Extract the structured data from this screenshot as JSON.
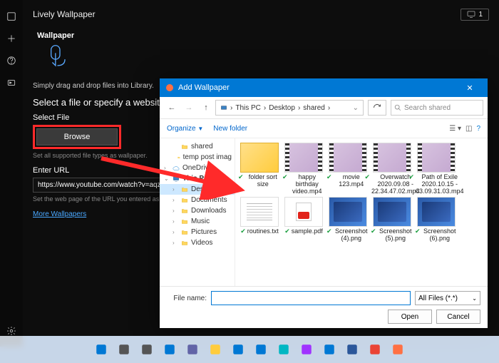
{
  "app": {
    "title": "Lively Wallpaper",
    "monitor_count": "1"
  },
  "wallpaper": {
    "heading": "Wallpaper",
    "drag_hint": "Simply drag and drop files into Library.",
    "select_line": "Select a file or specify a website url to",
    "select_file_label": "Select File",
    "browse_label": "Browse",
    "browse_hint": "Set all supported file types as wallpaper.",
    "url_label": "Enter URL",
    "url_value": "https://www.youtube.com/watch?v=aqz-KE",
    "url_hint": "Set the web page of the URL you entered as wallpaper.",
    "more_link": "More Wallpapers"
  },
  "dialog": {
    "title": "Add Wallpaper",
    "breadcrumb": [
      "This PC",
      "Desktop",
      "shared"
    ],
    "search_placeholder": "Search shared",
    "organize": "Organize",
    "new_folder": "New folder",
    "tree": [
      {
        "label": "shared",
        "icon": "folder",
        "indent": 1
      },
      {
        "label": "temp post imag",
        "icon": "folder",
        "indent": 1
      },
      {
        "label": "OneDrive",
        "icon": "cloud",
        "indent": 0,
        "chev": ">"
      },
      {
        "label": "This PC",
        "icon": "pc",
        "indent": 0,
        "chev": "v",
        "bold": true
      },
      {
        "label": "Desktop",
        "icon": "folder",
        "indent": 1,
        "chev": ">",
        "sel": true
      },
      {
        "label": "Documents",
        "icon": "folder",
        "indent": 1,
        "chev": ">"
      },
      {
        "label": "Downloads",
        "icon": "folder",
        "indent": 1,
        "chev": ">"
      },
      {
        "label": "Music",
        "icon": "folder",
        "indent": 1,
        "chev": ">"
      },
      {
        "label": "Pictures",
        "icon": "folder",
        "indent": 1,
        "chev": ">"
      },
      {
        "label": "Videos",
        "icon": "folder",
        "indent": 1,
        "chev": ">"
      }
    ],
    "files": [
      {
        "name": "folder sort size",
        "kind": "folder"
      },
      {
        "name": "happy birthday video.mp4",
        "kind": "film"
      },
      {
        "name": "movie 123.mp4",
        "kind": "film"
      },
      {
        "name": "Overwatch 2020.09.08 - 22.34.47.02.mp4",
        "kind": "film"
      },
      {
        "name": "Path of Exile 2020.10.15 - 03.09.31.03.mp4",
        "kind": "film"
      },
      {
        "name": "routines.txt",
        "kind": "txt"
      },
      {
        "name": "sample.pdf",
        "kind": "pdf"
      },
      {
        "name": "Screenshot (4).png",
        "kind": "shot"
      },
      {
        "name": "Screenshot (5).png",
        "kind": "shot"
      },
      {
        "name": "Screenshot (6).png",
        "kind": "shot"
      }
    ],
    "file_name_label": "File name:",
    "file_name_value": "",
    "filter": "All Files (*.*)",
    "open": "Open",
    "cancel": "Cancel"
  },
  "taskbar": {
    "icons": [
      "start",
      "search",
      "tasks",
      "widgets",
      "chat",
      "explorer",
      "store",
      "mail",
      "photos",
      "messenger",
      "edge",
      "word",
      "chrome",
      "lively"
    ]
  }
}
